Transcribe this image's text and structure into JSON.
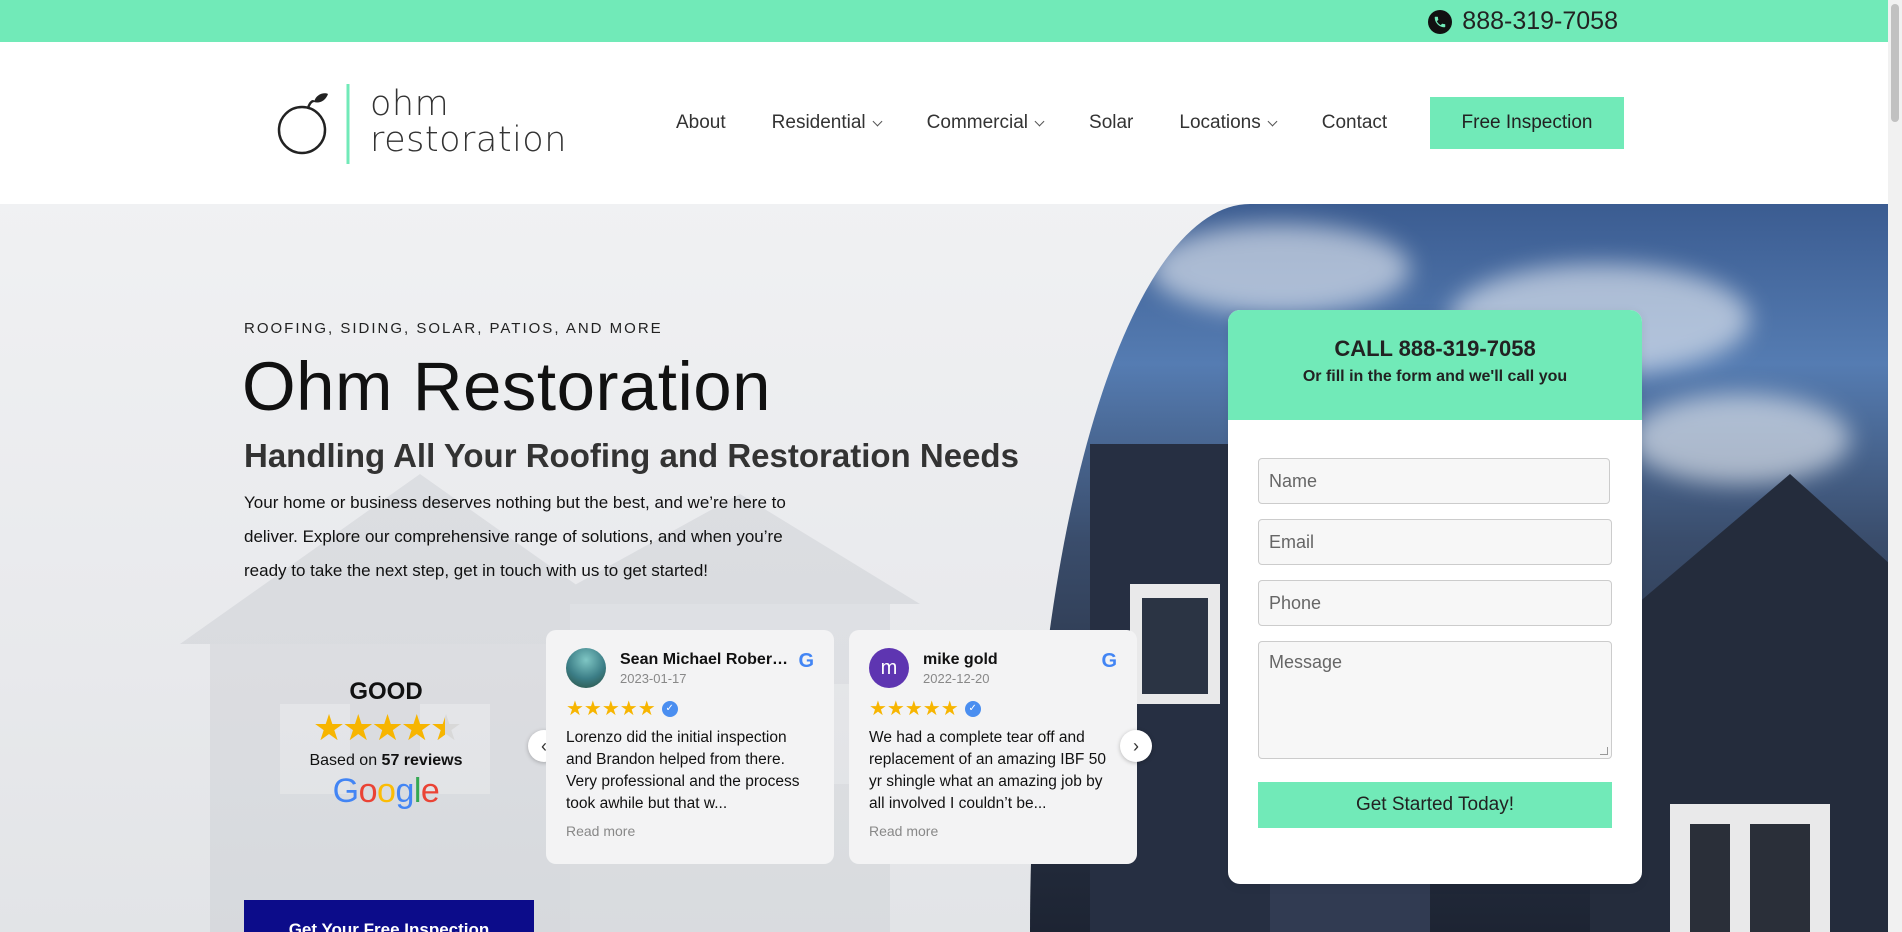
{
  "topbar": {
    "phone": "888-319-7058",
    "phone_icon": "phone-icon"
  },
  "header": {
    "logo": {
      "line1": "ohm",
      "line2": "restoration"
    },
    "nav": [
      {
        "label": "About",
        "dropdown": false
      },
      {
        "label": "Residential",
        "dropdown": true
      },
      {
        "label": "Commercial",
        "dropdown": true
      },
      {
        "label": "Solar",
        "dropdown": false
      },
      {
        "label": "Locations",
        "dropdown": true
      },
      {
        "label": "Contact",
        "dropdown": false
      }
    ],
    "cta": "Free Inspection"
  },
  "hero": {
    "kicker": "ROOFING, SIDING, SOLAR, PATIOS,  AND MORE",
    "title": "Ohm Restoration",
    "subtitle": "Handling All Your Roofing and Restoration Needs",
    "description": "Your home or business deserves nothing but the best, and we’re here to deliver. Explore our comprehensive range of solutions, and when you’re ready to take the next step, get in touch with us to get started!",
    "cta": "Get Your Free Inspection"
  },
  "rating": {
    "label": "GOOD",
    "stars": "★★★★★",
    "based_prefix": "Based on ",
    "count": "57 reviews",
    "platform": "Google",
    "score_fraction": 0.9
  },
  "reviews": [
    {
      "name": "Sean Michael Robert...",
      "date": "2023-01-17",
      "avatar_letter": "",
      "stars": "★★★★★",
      "text": "Lorenzo did the initial inspection and Brandon helped from there. Very professional and the process took awhile but that w...",
      "more": "Read more"
    },
    {
      "name": "mike gold",
      "date": "2022-12-20",
      "avatar_letter": "m",
      "stars": "★★★★★",
      "text": "We had a complete tear off and replacement of an amazing IBF 50 yr shingle what an amazing job by all involved I couldn’t be...",
      "more": "Read more"
    }
  ],
  "form": {
    "call": "CALL 888-319-7058",
    "sub": "Or fill in the form and we'll call you",
    "name_placeholder": "Name",
    "email_placeholder": "Email",
    "phone_placeholder": "Phone",
    "message_placeholder": "Message",
    "submit": "Get Started Today!"
  },
  "colors": {
    "accent": "#71eab8",
    "navy": "#0c0c8a",
    "star": "#f7b500"
  }
}
